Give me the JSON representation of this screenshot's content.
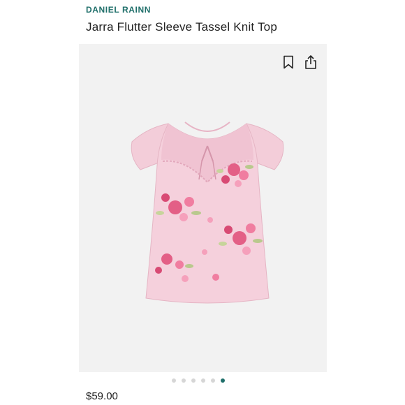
{
  "product": {
    "brand": "DANIEL RAINN",
    "title": "Jarra Flutter Sleeve Tassel Knit Top",
    "price": "$59.00",
    "brand_color": "#1f6f6a",
    "image_description_icon": "blouse-floral-image"
  },
  "actions": {
    "bookmark_icon": "bookmark-icon",
    "share_icon": "share-icon"
  },
  "carousel": {
    "total": 6,
    "active_index": 5,
    "active_color": "#1f6f6a",
    "inactive_color": "#d6d6d6"
  }
}
